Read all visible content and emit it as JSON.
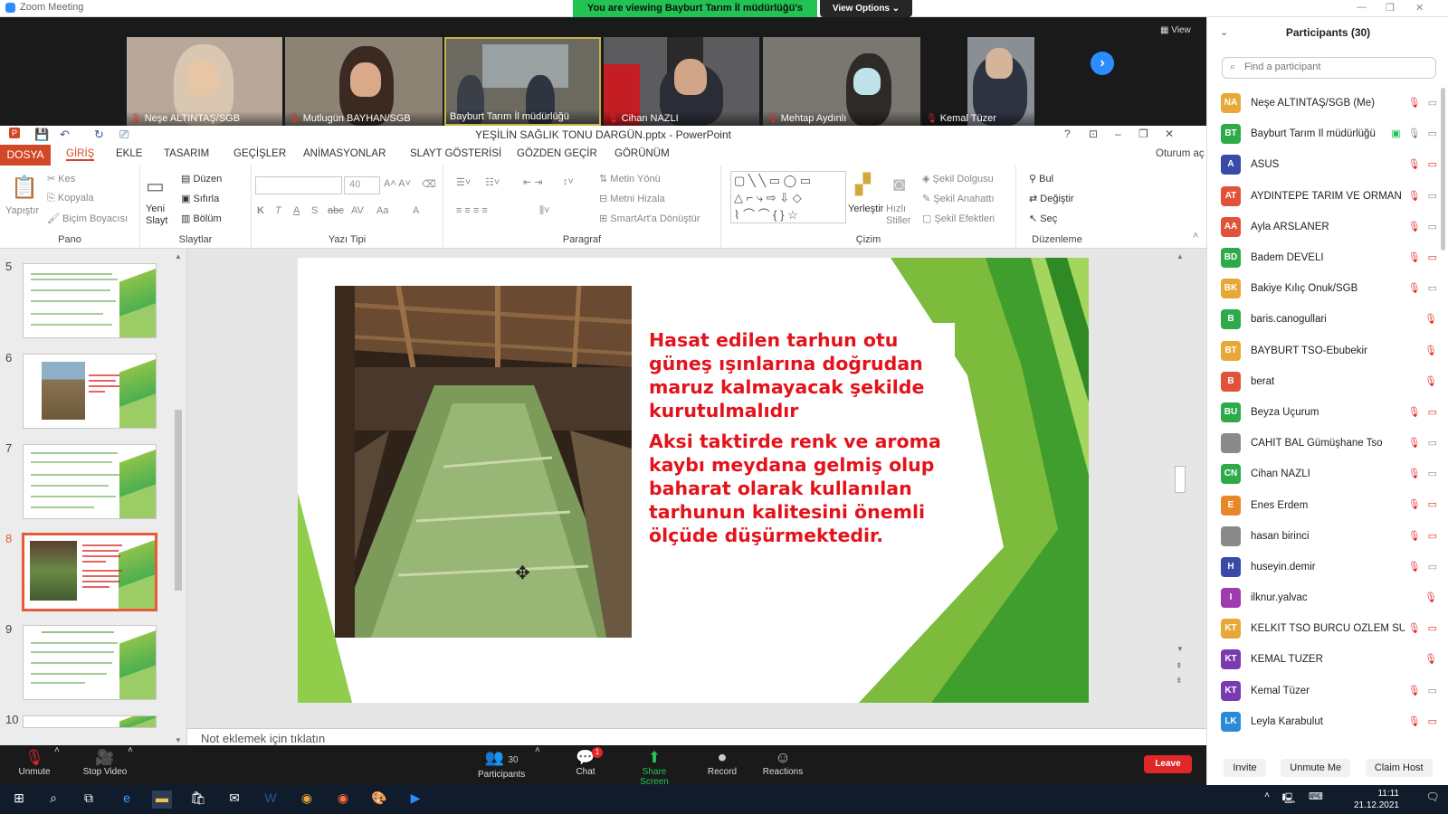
{
  "zoom": {
    "window_title": "Zoom Meeting",
    "viewing_banner": "You are viewing Bayburt Tarım İl müdürlüğü's screen",
    "view_options": "View Options ⌄",
    "view_label": "View",
    "video_tiles": [
      {
        "name": "Neşe ALTINTAŞ/SGB"
      },
      {
        "name": "Mutlugün BAYHAN/SGB"
      },
      {
        "name": "Bayburt Tarım İl müdürlüğü"
      },
      {
        "name": "Cihan NAZLI"
      },
      {
        "name": "Mehtap Aydınlı"
      },
      {
        "name": "Kemal Tüzer"
      }
    ],
    "toolbar": {
      "unmute": "Unmute",
      "stop_video": "Stop Video",
      "participants": "Participants",
      "participants_count": "30",
      "chat": "Chat",
      "chat_badge": "1",
      "share_screen": "Share Screen",
      "record": "Record",
      "reactions": "Reactions",
      "leave": "Leave"
    }
  },
  "participants_panel": {
    "title": "Participants (30)",
    "search_placeholder": "Find a participant",
    "invite": "Invite",
    "unmute_me": "Unmute Me",
    "claim_host": "Claim Host",
    "list": [
      {
        "initials": "NA",
        "name": "Neşe ALTINTAŞ/SGB (Me)",
        "color": "#e8a838",
        "cam": "on"
      },
      {
        "initials": "BT",
        "name": "Bayburt Tarım İl müdürlüğü",
        "color": "#2eaa4a",
        "cam": "on",
        "sharing": true
      },
      {
        "initials": "A",
        "name": "ASUS",
        "color": "#3a4aa8",
        "cam": "off"
      },
      {
        "initials": "AT",
        "name": "AYDINTEPE TARIM VE ORMAN ...",
        "color": "#e0533a",
        "cam": "on"
      },
      {
        "initials": "AA",
        "name": "Ayla ARSLANER",
        "color": "#e0533a",
        "cam": "on"
      },
      {
        "initials": "BD",
        "name": "Badem DEVELİ",
        "color": "#2eaa4a",
        "cam": "off"
      },
      {
        "initials": "BK",
        "name": "Bakiye Kılıç Onuk/SGB",
        "color": "#e8a838",
        "cam": "on"
      },
      {
        "initials": "B",
        "name": "baris.canogullari",
        "color": "#2eaa4a",
        "cam": "none"
      },
      {
        "initials": "BT",
        "name": "BAYBURT TSO-Ebubekir",
        "color": "#e8a838",
        "cam": "none"
      },
      {
        "initials": "B",
        "name": "berat",
        "color": "#e0533a",
        "cam": "none"
      },
      {
        "initials": "BU",
        "name": "Beyza Uçurum",
        "color": "#2eaa4a",
        "cam": "off"
      },
      {
        "initials": "",
        "name": "CAHİT BAL Gümüşhane Tso",
        "color": "#8a8a8a",
        "cam": "on"
      },
      {
        "initials": "CN",
        "name": "Cihan NAZLI",
        "color": "#2eaa4a",
        "cam": "on"
      },
      {
        "initials": "E",
        "name": "Enes Erdem",
        "color": "#e8862a",
        "cam": "off"
      },
      {
        "initials": "",
        "name": "hasan birinci",
        "color": "#8a8a8a",
        "cam": "off"
      },
      {
        "initials": "H",
        "name": "huseyin.demir",
        "color": "#3a4aa8",
        "cam": "on"
      },
      {
        "initials": "I",
        "name": "ilknur.yalvac",
        "color": "#a03ab0",
        "cam": "none"
      },
      {
        "initials": "KT",
        "name": "KELKİT TSO BURCU ÖZLEM SU...",
        "color": "#e8a838",
        "cam": "off"
      },
      {
        "initials": "KT",
        "name": "KEMAL TÜZER",
        "color": "#7a3ab0",
        "cam": "none"
      },
      {
        "initials": "KT",
        "name": "Kemal Tüzer",
        "color": "#7a3ab0",
        "cam": "on"
      },
      {
        "initials": "LK",
        "name": "Leyla Karabulut",
        "color": "#2a8ad8",
        "cam": "off"
      }
    ]
  },
  "powerpoint": {
    "doc_title": "YEŞİLİN SAĞLIK TONU DARGÜN.pptx - PowerPoint",
    "sign_in": "Oturum aç",
    "tabs": [
      "DOSYA",
      "GİRİŞ",
      "EKLE",
      "TASARIM",
      "GEÇİŞLER",
      "ANİMASYONLAR",
      "SLAYT GÖSTERİSİ",
      "GÖZDEN GEÇİR",
      "GÖRÜNÜM"
    ],
    "ribbon": {
      "pano": {
        "label": "Pano",
        "paste": "Yapıştır",
        "cut": "Kes",
        "copy": "Kopyala",
        "format_painter": "Biçim Boyacısı"
      },
      "slaytlar": {
        "label": "Slaytlar",
        "new_slide": "Yeni Slayt",
        "layout": "Düzen",
        "reset": "Sıfırla",
        "section": "Bölüm"
      },
      "yazi_tipi": {
        "label": "Yazı Tipi",
        "font_size": "40",
        "bold": "K",
        "italic": "T",
        "underline": "A",
        "shadow": "S",
        "strike": "abc",
        "spacing": "AV",
        "case": "Aa",
        "color": "A"
      },
      "paragraf": {
        "label": "Paragraf",
        "text_direction": "Metin Yönü",
        "align_text": "Metni Hizala",
        "smartart": "SmartArt'a Dönüştür"
      },
      "cizim": {
        "label": "Çizim",
        "arrange": "Yerleştir",
        "quick_styles": "Hızlı Stiller",
        "shape_fill": "Şekil Dolgusu",
        "shape_outline": "Şekil Anahattı",
        "shape_effects": "Şekil Efektleri"
      },
      "duzenleme": {
        "label": "Düzenleme",
        "find": "Bul",
        "replace": "Değiştir",
        "select": "Seç"
      }
    },
    "slide_numbers": [
      "5",
      "6",
      "7",
      "8",
      "9",
      "10"
    ],
    "selected_slide": "8",
    "slide_text": {
      "p1": "Hasat edilen tarhun otu güneş ışınlarına doğrudan maruz kalmayacak şekilde kurutulmalıdır",
      "p2": "Aksi taktirde renk ve aroma kaybı meydana gelmiş olup baharat olarak kullanılan tarhunun kalitesini önemli ölçüde düşürmektedir."
    },
    "notes_placeholder": "Not eklemek için tıklatın"
  },
  "taskbar": {
    "time": "11:11",
    "date": "21.12.2021"
  }
}
